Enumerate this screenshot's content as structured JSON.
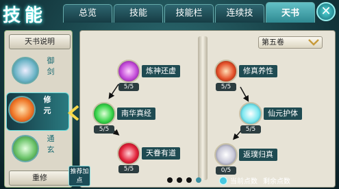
{
  "window": {
    "title": "技能"
  },
  "tabs": [
    {
      "label": "总览",
      "active": false
    },
    {
      "label": "技能",
      "active": false
    },
    {
      "label": "技能栏",
      "active": false
    },
    {
      "label": "连续技",
      "active": false
    },
    {
      "label": "天书",
      "active": true
    }
  ],
  "close_icon": "close-icon",
  "sidebar": {
    "top_button": "天书说明",
    "schools": [
      {
        "label": "御剑",
        "active": false,
        "color": "#9fd6e2"
      },
      {
        "label": "修元",
        "active": true,
        "color": "#f07a2a"
      },
      {
        "label": "通玄",
        "active": false,
        "color": "#6cc46a"
      }
    ],
    "bottom_button": "重修"
  },
  "volume_select": {
    "value": "第五卷"
  },
  "skills": [
    {
      "name": "炼神还虚",
      "level": "5/5",
      "color": "#c24ad8"
    },
    {
      "name": "南华真经",
      "level": "5/5",
      "color": "#39d44a"
    },
    {
      "name": "天眷有道",
      "level": "5/5",
      "color": "#e2233a"
    },
    {
      "name": "修真养性",
      "level": "5/5",
      "color": "#e4502a"
    },
    {
      "name": "仙元护体",
      "level": "5/5",
      "color": "#7ee8f0"
    },
    {
      "name": "返璞归真",
      "level": "0/5",
      "color": "#c8c8d8"
    }
  ],
  "recommend_button": "推荐加点",
  "page_dots": [
    false,
    false,
    false,
    true
  ],
  "points": {
    "current_label": "当前点数",
    "current_value": "",
    "remaining_label": "剩余点数",
    "remaining_value": ""
  },
  "colors": {
    "accent": "#2f8a92",
    "panel": "#e7e3d6",
    "label_bg": "#1f4b52"
  }
}
